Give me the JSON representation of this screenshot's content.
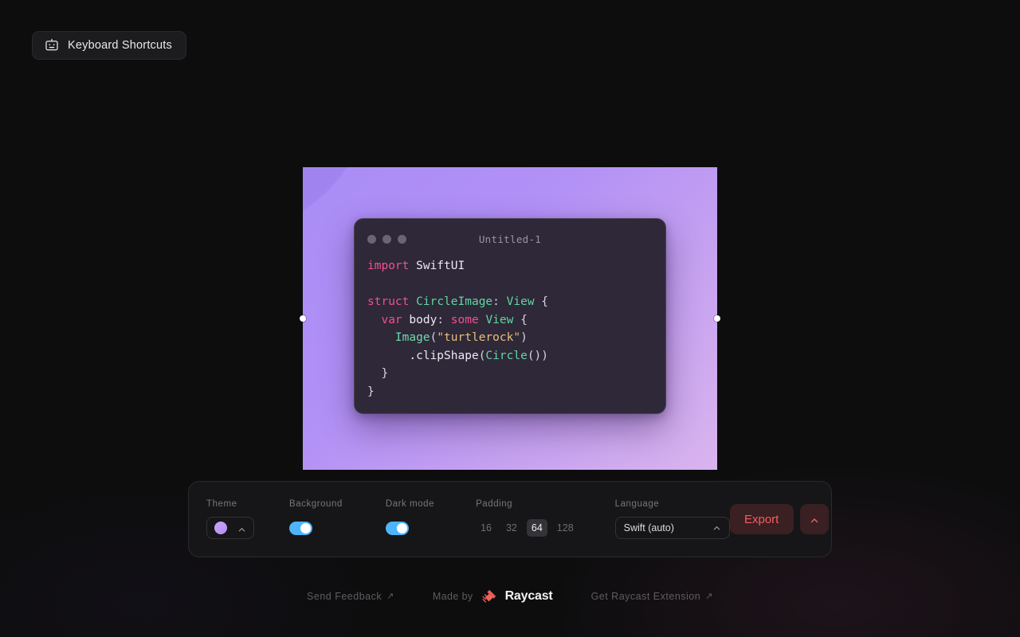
{
  "header": {
    "shortcuts_button_label": "Keyboard Shortcuts",
    "shortcuts_icon": "keyboard-icon"
  },
  "preview": {
    "background_gradient_start": "#a98cf6",
    "background_gradient_end": "#d9b4ee",
    "resize_handle_color": "#ffffff",
    "window": {
      "title": "Untitled-1",
      "traffic_light_color": "#6b6477",
      "window_background": "#2e2838",
      "code_lines": [
        [
          {
            "t": "import",
            "c": "tk-key"
          },
          {
            "t": " SwiftUI",
            "c": "tk-plain"
          }
        ],
        [],
        [
          {
            "t": "struct",
            "c": "tk-key"
          },
          {
            "t": " ",
            "c": "tk-plain"
          },
          {
            "t": "CircleImage",
            "c": "tk-type"
          },
          {
            "t": ": ",
            "c": "tk-punc"
          },
          {
            "t": "View",
            "c": "tk-type"
          },
          {
            "t": " {",
            "c": "tk-punc"
          }
        ],
        [
          {
            "t": "  ",
            "c": "tk-plain"
          },
          {
            "t": "var",
            "c": "tk-key"
          },
          {
            "t": " body",
            "c": "tk-plain"
          },
          {
            "t": ": ",
            "c": "tk-punc"
          },
          {
            "t": "some",
            "c": "tk-key"
          },
          {
            "t": " ",
            "c": "tk-plain"
          },
          {
            "t": "View",
            "c": "tk-type"
          },
          {
            "t": " {",
            "c": "tk-punc"
          }
        ],
        [
          {
            "t": "    ",
            "c": "tk-plain"
          },
          {
            "t": "Image",
            "c": "tk-fn"
          },
          {
            "t": "(",
            "c": "tk-punc"
          },
          {
            "t": "\"turtlerock\"",
            "c": "tk-str"
          },
          {
            "t": ")",
            "c": "tk-punc"
          }
        ],
        [
          {
            "t": "      .clipShape",
            "c": "tk-plain"
          },
          {
            "t": "(",
            "c": "tk-punc"
          },
          {
            "t": "Circle",
            "c": "tk-type"
          },
          {
            "t": "())",
            "c": "tk-punc"
          }
        ],
        [
          {
            "t": "  }",
            "c": "tk-punc"
          }
        ],
        [
          {
            "t": "}",
            "c": "tk-punc"
          }
        ]
      ]
    }
  },
  "toolbar": {
    "theme": {
      "label": "Theme",
      "swatch_color": "#b48cf3",
      "chevron": "chevron-up-icon"
    },
    "background": {
      "label": "Background",
      "enabled": true,
      "accent": "#4cb5fb"
    },
    "dark_mode": {
      "label": "Dark mode",
      "enabled": true,
      "accent": "#4cb5fb"
    },
    "padding": {
      "label": "Padding",
      "options": [
        "16",
        "32",
        "64",
        "128"
      ],
      "selected": "64"
    },
    "language": {
      "label": "Language",
      "selected": "Swift (auto)",
      "chevron": "chevron-up-icon"
    },
    "export": {
      "label": "Export",
      "text_color": "#f2615c",
      "background_color": "#3a1f23",
      "more_chevron": "chevron-up-icon"
    }
  },
  "footer": {
    "send_feedback": "Send Feedback",
    "send_feedback_arrow": "↗",
    "made_by": "Made by",
    "brand": "Raycast",
    "brand_logo": "raycast-logo",
    "get_extension": "Get Raycast Extension",
    "get_extension_arrow": "↗"
  }
}
